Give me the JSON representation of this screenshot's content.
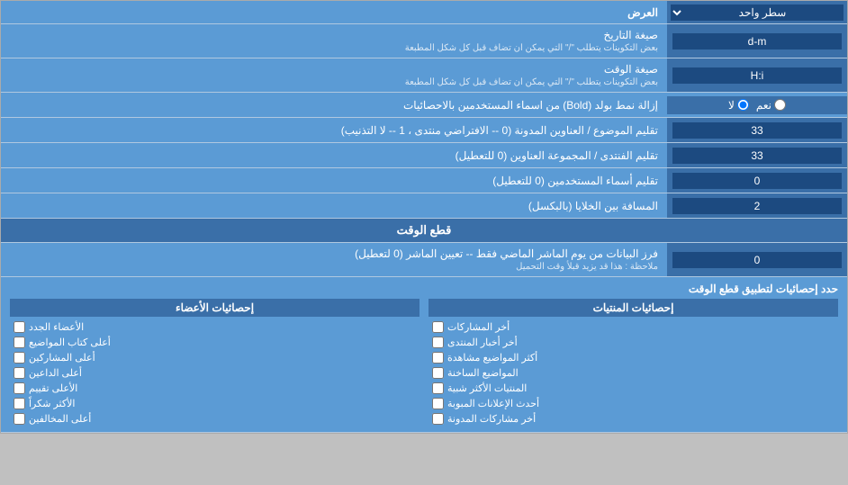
{
  "header": {
    "label": "العرض",
    "single_row_label": "سطر واحد",
    "single_row_value": "سطر واحد"
  },
  "date_format": {
    "label": "صيغة التاريخ",
    "sublabel": "بعض التكوينات يتطلب \"/\" التي يمكن ان تضاف قبل كل شكل المطبعة",
    "value": "d-m"
  },
  "time_format": {
    "label": "صيغة الوقت",
    "sublabel": "بعض التكوينات يتطلب \"/\" التي يمكن ان تضاف قبل كل شكل المطبعة",
    "value": "H:i"
  },
  "bold_remove": {
    "label": "إزالة نمط بولد (Bold) من اسماء المستخدمين بالاحصائيات",
    "option1": "نعم",
    "option2": "لا",
    "selected": "لا"
  },
  "topics_limit": {
    "label": "تقليم الموضوع / العناوين المدونة (0 -- الافتراضي منتدى ، 1 -- لا التذنيب)",
    "value": "33"
  },
  "forum_limit": {
    "label": "تقليم الفنتدى / المجموعة العناوين (0 للتعطيل)",
    "value": "33"
  },
  "users_limit": {
    "label": "تقليم أسماء المستخدمين (0 للتعطيل)",
    "value": "0"
  },
  "cells_space": {
    "label": "المسافة بين الخلايا (بالبكسل)",
    "value": "2"
  },
  "time_cut_section": {
    "label": "قطع الوقت"
  },
  "time_cut_value": {
    "label": "فرز البيانات من يوم الماشر الماضي فقط -- تعيين الماشر (0 لتعطيل)",
    "note": "ملاحظة : هذا قد يزيد قبلأ وقت التحميل",
    "value": "0"
  },
  "stats_apply": {
    "label": "حدد إحصائيات لتطبيق قطع الوقت"
  },
  "stats_posts": {
    "header": "إحصائيات المنتيات",
    "items": [
      "أخر المشاركات",
      "أخر أخبار المنتدى",
      "أكثر المواضيع مشاهدة",
      "المواضيع الساخنة",
      "المنتيات الأكثر شبية",
      "أحدث الإعلانات المبوبة",
      "أخر مشاركات المدونة"
    ]
  },
  "stats_members": {
    "header": "إحصائيات الأعضاء",
    "items": [
      "الأعضاء الجدد",
      "أعلى كتاب المواضيع",
      "أعلى المشاركين",
      "أعلى الداعين",
      "الأعلى تقييم",
      "الأكثر شكراً",
      "أعلى المخالفين"
    ]
  }
}
